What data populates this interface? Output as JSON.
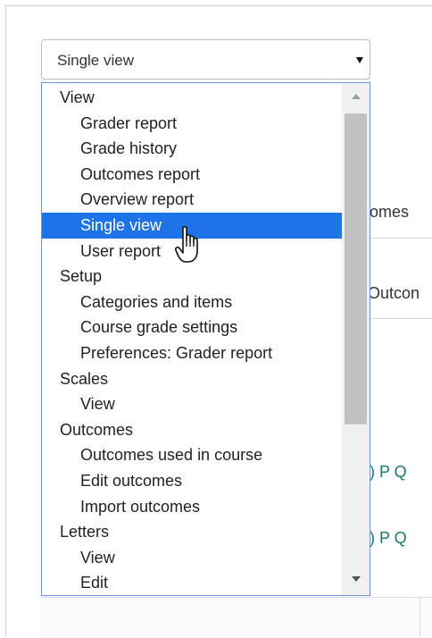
{
  "select": {
    "value": "Single view"
  },
  "dropdown": {
    "options": [
      {
        "label": "View",
        "type": "group"
      },
      {
        "label": "Grader report",
        "type": "item"
      },
      {
        "label": "Grade history",
        "type": "item"
      },
      {
        "label": "Outcomes report",
        "type": "item"
      },
      {
        "label": "Overview report",
        "type": "item"
      },
      {
        "label": "Single view",
        "type": "item",
        "selected": true
      },
      {
        "label": "User report",
        "type": "item"
      },
      {
        "label": "Setup",
        "type": "group"
      },
      {
        "label": "Categories and items",
        "type": "item"
      },
      {
        "label": "Course grade settings",
        "type": "item"
      },
      {
        "label": "Preferences: Grader report",
        "type": "item"
      },
      {
        "label": "Scales",
        "type": "group"
      },
      {
        "label": "View",
        "type": "item"
      },
      {
        "label": "Outcomes",
        "type": "group"
      },
      {
        "label": "Outcomes used in course",
        "type": "item"
      },
      {
        "label": "Edit outcomes",
        "type": "item"
      },
      {
        "label": "Import outcomes",
        "type": "item"
      },
      {
        "label": "Letters",
        "type": "group"
      },
      {
        "label": "View",
        "type": "item"
      },
      {
        "label": "Edit",
        "type": "item"
      }
    ]
  },
  "background": {
    "frag_1": "omes",
    "frag_2": "Outcon",
    "frag_3": ") P Q",
    "frag_4": ") P Q"
  },
  "colors": {
    "selected_bg": "#1e73e8",
    "dropdown_border": "#6f94d6",
    "link": "#1a7a63"
  },
  "icons": {
    "select_arrow": "caret-down-icon",
    "scroll_up": "scroll-up-arrow-icon",
    "scroll_down": "scroll-down-arrow-icon",
    "cursor": "hand-pointer-icon"
  }
}
